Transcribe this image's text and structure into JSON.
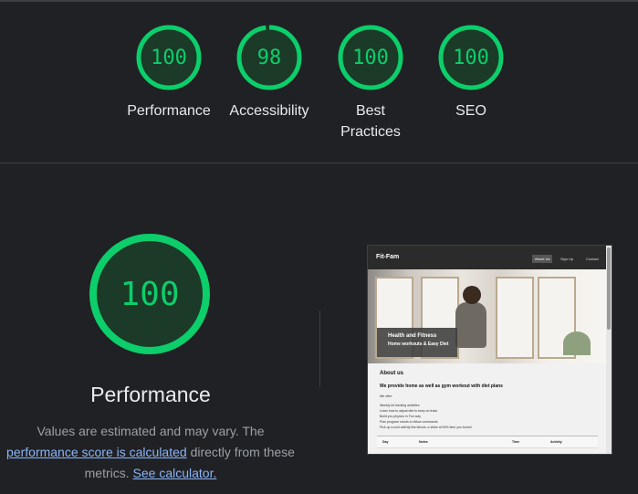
{
  "summary": {
    "gauges": [
      {
        "score": "100",
        "label": "Performance"
      },
      {
        "score": "98",
        "label": "Accessibility",
        "fraction": 0.98
      },
      {
        "score": "100",
        "label": "Best Practices"
      },
      {
        "score": "100",
        "label": "SEO"
      }
    ]
  },
  "performance": {
    "score": "100",
    "title": "Performance",
    "desc_prefix": "Values are estimated and may vary. The ",
    "link1": "performance score is calculated",
    "desc_mid": " directly from these metrics. ",
    "link2": "See calculator."
  },
  "colors": {
    "pass": "#0cce6b",
    "background": "#202124",
    "link": "#8ab4f8"
  },
  "thumbnail": {
    "brand": "Fit-Fam",
    "nav": [
      "About Us",
      "Sign Up",
      "Contact"
    ],
    "hero_title": "Health and Fitness",
    "hero_sub": "Home workouts & Easy Diet",
    "about_heading": "About us",
    "about_sub": "We provide home as well as gym workout with diet plans",
    "offer_label": "We offer:",
    "offer_items": [
      "Weekly kit tracking activities",
      "Learn how to adjust diet to keep on track",
      "Build you physics in Fun way",
      "Plan program robots to follow commands",
      "Pick up a cool activity like kitools, a strike at 90% time you burnel"
    ],
    "table_headers": [
      "Day",
      "Notes",
      "Time",
      "Activity"
    ]
  }
}
